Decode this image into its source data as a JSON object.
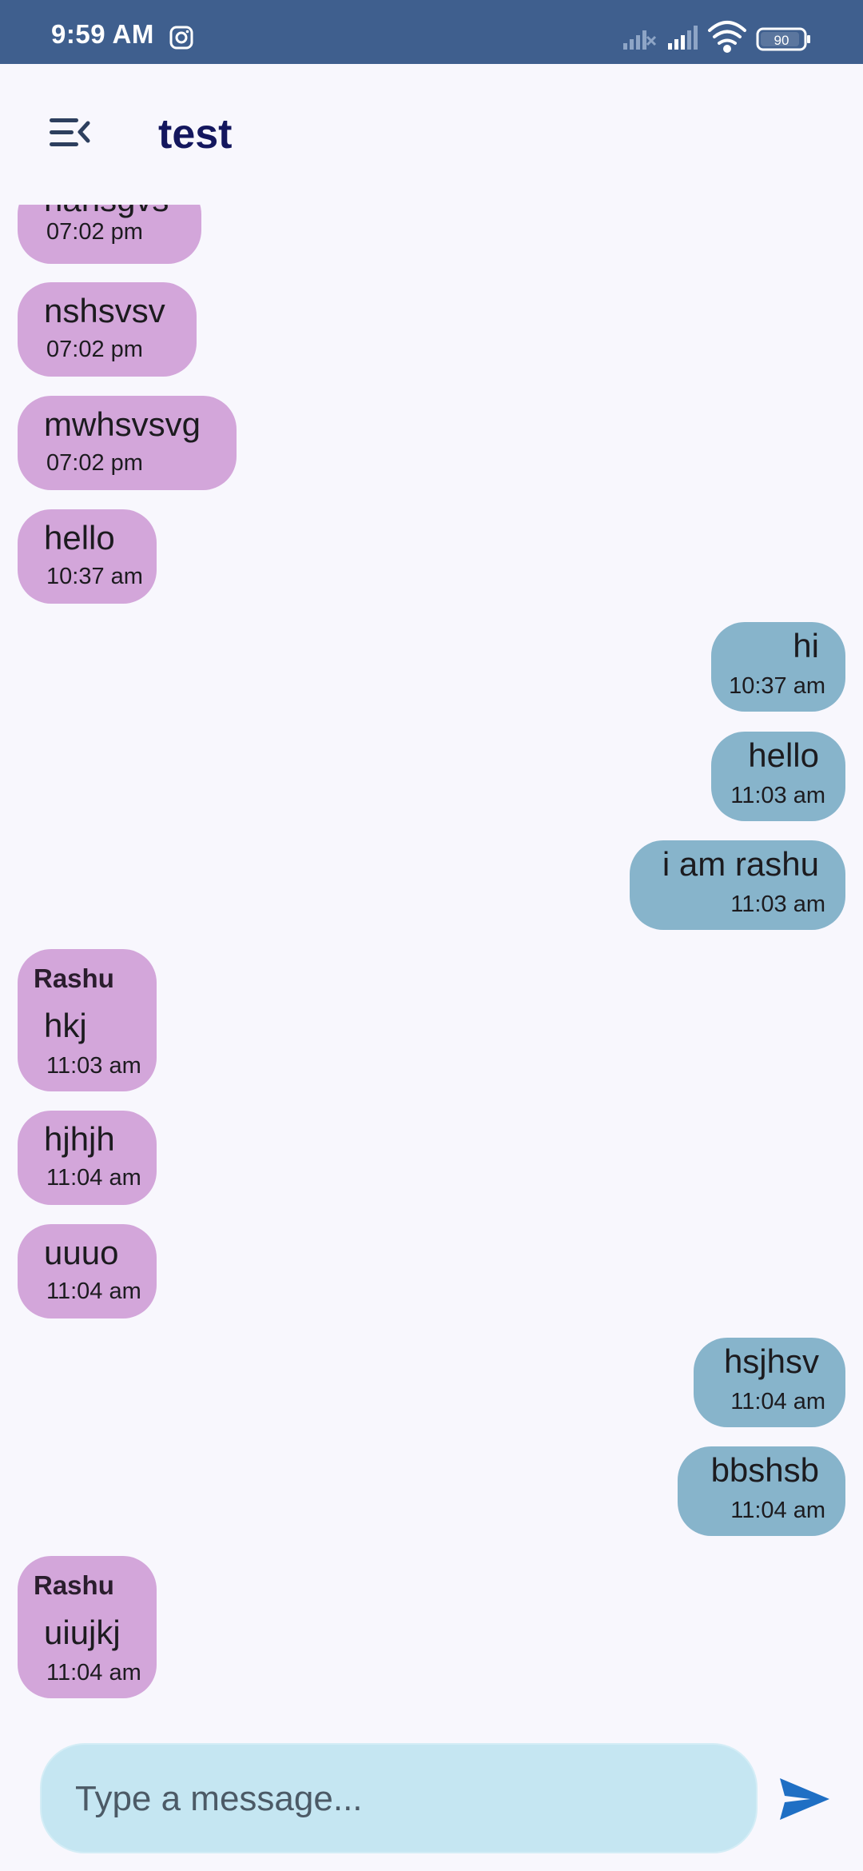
{
  "status_bar": {
    "time": "9:59 AM",
    "battery": "90",
    "icons": [
      "instagram-icon",
      "signal-icon",
      "signal-icon",
      "wifi-icon",
      "battery-icon"
    ]
  },
  "app_bar": {
    "title": "test",
    "menu_icon": "menu-collapse-icon"
  },
  "colors": {
    "status_bar": "#3f5f8e",
    "background": "#f8f7fd",
    "incoming_bubble": "#d3a6da",
    "outgoing_bubble": "#87b4cb",
    "composer": "#c5e6f2",
    "title": "#14175e",
    "send_icon": "#1f6fc4"
  },
  "messages": [
    {
      "direction": "in",
      "sender": "",
      "text": "nansgvs",
      "time": "07:02 pm"
    },
    {
      "direction": "in",
      "sender": "",
      "text": "nshsvsv",
      "time": "07:02 pm"
    },
    {
      "direction": "in",
      "sender": "",
      "text": "mwhsvsvg",
      "time": "07:02 pm"
    },
    {
      "direction": "in",
      "sender": "",
      "text": "hello",
      "time": "10:37 am"
    },
    {
      "direction": "out",
      "sender": "",
      "text": "hi",
      "time": "10:37 am"
    },
    {
      "direction": "out",
      "sender": "",
      "text": "hello",
      "time": "11:03 am"
    },
    {
      "direction": "out",
      "sender": "",
      "text": "i am rashu",
      "time": "11:03 am"
    },
    {
      "direction": "in",
      "sender": "Rashu",
      "text": "hkj",
      "time": "11:03 am"
    },
    {
      "direction": "in",
      "sender": "",
      "text": "hjhjh",
      "time": "11:04 am"
    },
    {
      "direction": "in",
      "sender": "",
      "text": "uuuo",
      "time": "11:04 am"
    },
    {
      "direction": "out",
      "sender": "",
      "text": "hsjhsv",
      "time": "11:04 am"
    },
    {
      "direction": "out",
      "sender": "",
      "text": "bbshsb",
      "time": "11:04 am"
    },
    {
      "direction": "in",
      "sender": "Rashu",
      "text": "uiujkj",
      "time": "11:04 am"
    }
  ],
  "composer": {
    "placeholder": "Type a message...",
    "value": "",
    "send_icon": "send-icon"
  }
}
